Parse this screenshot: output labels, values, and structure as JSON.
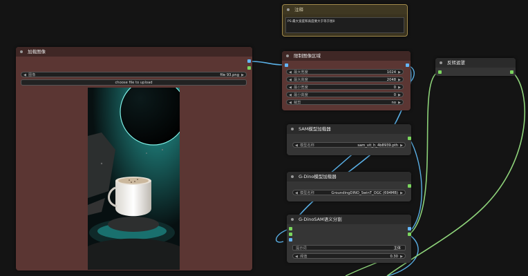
{
  "nodes": {
    "load_image": {
      "title": "加载图像",
      "widget_label": "图像",
      "widget_value": "file 93.png",
      "upload_button": "choose file to upload"
    },
    "note": {
      "title": "注释",
      "text": "PS:最大宽度和高度要大于等于图0"
    },
    "limit": {
      "title": "限制图像区域",
      "rows": [
        {
          "label": "最大宽度",
          "value": "1024"
        },
        {
          "label": "最大高度",
          "value": "2048"
        },
        {
          "label": "最小宽度",
          "value": "0"
        },
        {
          "label": "最小高度",
          "value": "0"
        },
        {
          "label": "裁剪",
          "value": "no"
        }
      ]
    },
    "invert": {
      "title": "反转遮罩"
    },
    "sam": {
      "title": "SAM模型加载器",
      "widget_label": "模型名称",
      "widget_value": "sam_vit_h_4b8939.pth"
    },
    "gdino": {
      "title": "G-Dino模型加载器",
      "widget_label": "模型名称",
      "widget_value": "GroundingDINO_SwinT_OGC (694MB)"
    },
    "gdsam": {
      "title": "G-DinoSAM语义分割",
      "prompt_label": "提示词",
      "prompt_value": "主体",
      "threshold_label": "阈值",
      "threshold_value": "0.30"
    }
  },
  "colors": {
    "canvas": "#141414",
    "node_body": "#353535",
    "node_title": "#2b2b2b",
    "red_node_body": "#5b3633",
    "red_node_title": "#3f2725",
    "note_body": "#3a331f",
    "note_border": "#a18a4c",
    "link_blue": "#5ab0e6",
    "link_green": "#8ed37a",
    "port_blue": "#64b5f6",
    "port_green": "#7bd65e"
  },
  "icons": {
    "arrow_left": "◀",
    "arrow_right": "▶"
  }
}
